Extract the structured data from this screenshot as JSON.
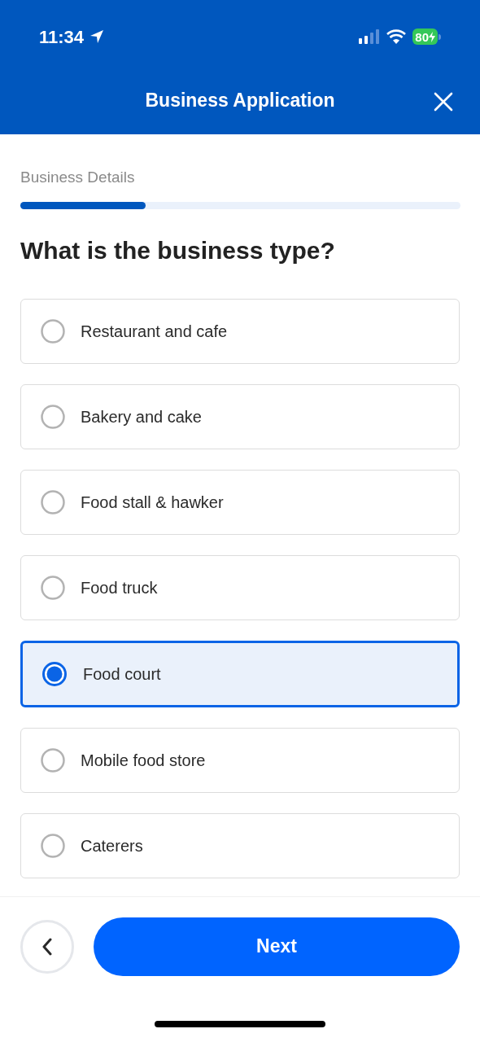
{
  "status_bar": {
    "time": "11:34",
    "battery": "80"
  },
  "header": {
    "title": "Business Application"
  },
  "progress": {
    "label": "Business Details",
    "level": 0.285
  },
  "question": "What is the business type?",
  "options": [
    {
      "label": "Restaurant and cafe",
      "selected": false
    },
    {
      "label": "Bakery and cake",
      "selected": false
    },
    {
      "label": "Food stall & hawker",
      "selected": false
    },
    {
      "label": "Food truck",
      "selected": false
    },
    {
      "label": "Food court",
      "selected": true
    },
    {
      "label": "Mobile food store",
      "selected": false
    },
    {
      "label": "Caterers",
      "selected": false
    }
  ],
  "footer": {
    "next_label": "Next"
  }
}
